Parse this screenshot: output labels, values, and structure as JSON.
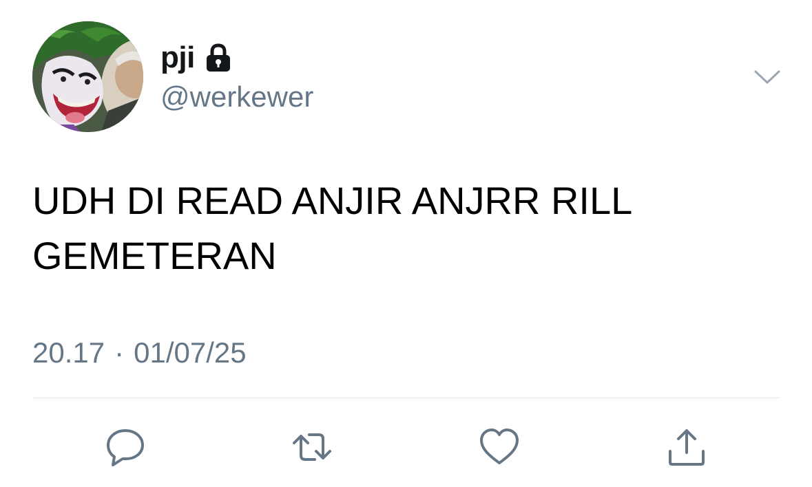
{
  "tweet": {
    "display_name": "pji",
    "handle": "@werkewer",
    "protected": true,
    "text_line1": "UDH DI READ ANJIR ANJRR RILL",
    "text_line2": "GEMETERAN",
    "time": "20.17",
    "separator": "·",
    "date": "01/07/25"
  },
  "icons": {
    "lock": "lock-icon",
    "more": "chevron-down-icon",
    "reply": "reply-icon",
    "retweet": "retweet-icon",
    "like": "heart-icon",
    "share": "share-icon"
  },
  "colors": {
    "primary_text": "#14171a",
    "secondary_text": "#657786",
    "divider": "#e1e8ed",
    "icon": "#657786"
  }
}
